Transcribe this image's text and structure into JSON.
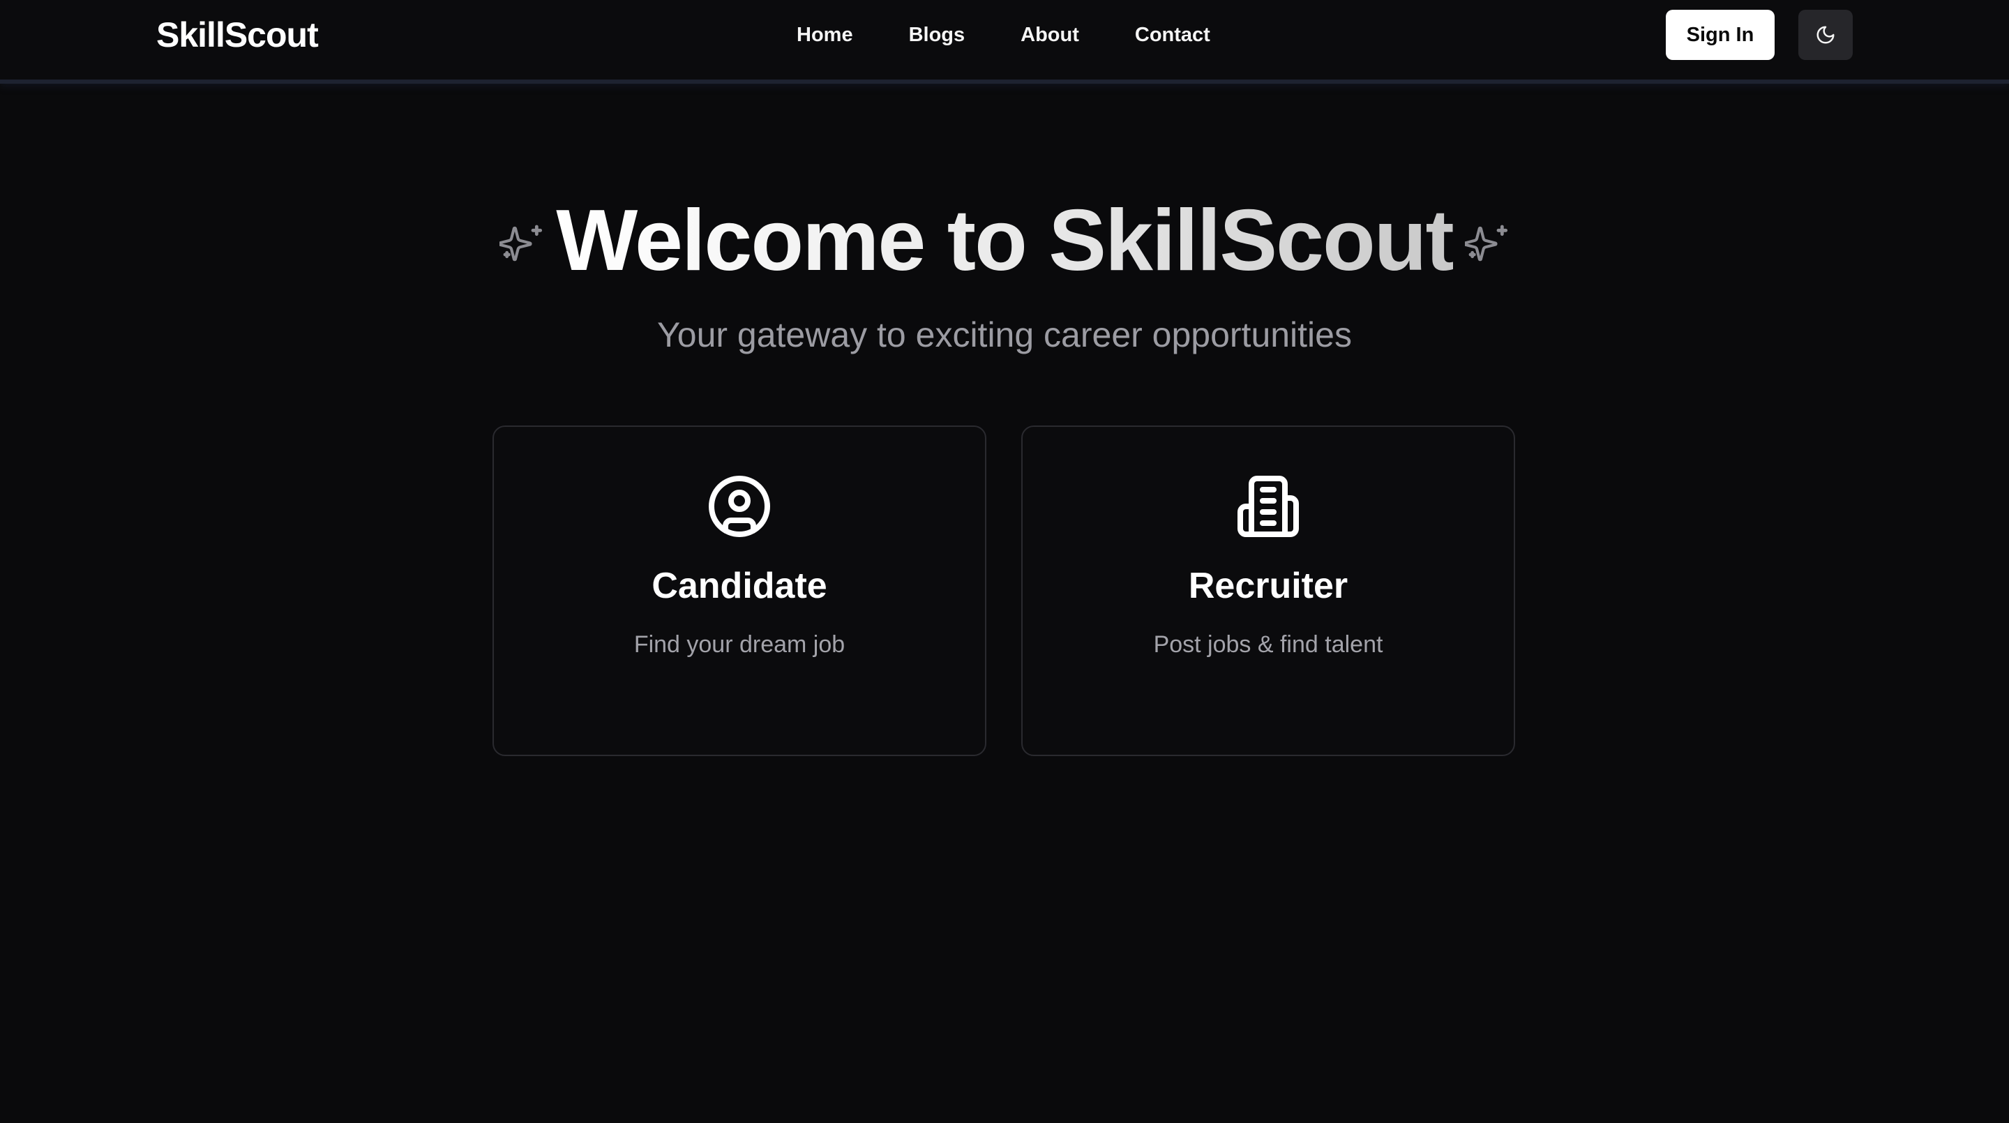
{
  "header": {
    "logo": "SkillScout",
    "nav": [
      {
        "label": "Home"
      },
      {
        "label": "Blogs"
      },
      {
        "label": "About"
      },
      {
        "label": "Contact"
      }
    ],
    "sign_in_label": "Sign In",
    "theme_toggle_icon": "moon-icon"
  },
  "hero": {
    "title": "Welcome to SkillScout",
    "subtitle": "Your gateway to exciting career opportunities",
    "decoration_icon": "sparkles-icon"
  },
  "cards": [
    {
      "icon": "user-circle-icon",
      "title": "Candidate",
      "description": "Find your dream job"
    },
    {
      "icon": "building-icon",
      "title": "Recruiter",
      "description": "Post jobs & find talent"
    }
  ],
  "colors": {
    "background": "#0a0a0c",
    "header_border": "#1d2230",
    "card_border": "#2a2a2f",
    "muted_text": "#9c9ca3",
    "primary_button_bg": "#ffffff"
  }
}
